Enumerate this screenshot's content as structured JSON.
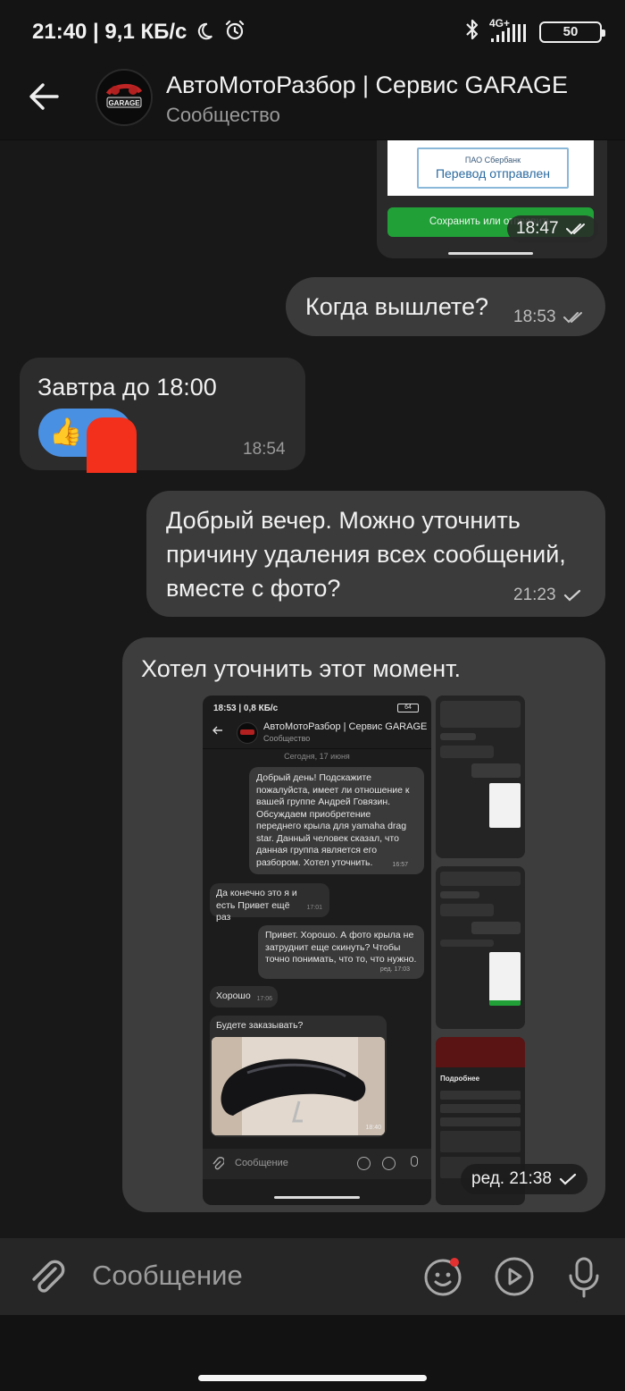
{
  "status_bar": {
    "time_speed": "21:40 | 9,1 КБ/с",
    "network": "4G+",
    "battery": "50",
    "icons": [
      "moon-icon",
      "alarm-icon",
      "bluetooth-icon",
      "signal-icon",
      "battery-icon"
    ]
  },
  "header": {
    "title": "АвтоМотоРазбор  | Сервис GARAGE",
    "subtitle": "Сообщество",
    "avatar_text": "GARAGE"
  },
  "messages": [
    {
      "id": "m1",
      "direction": "out",
      "type": "image-card",
      "card": {
        "bank": "ПАО Сбербанк",
        "status": "Перевод отправлен",
        "button": "Сохранить или отправить"
      },
      "time": "18:47",
      "check": "double"
    },
    {
      "id": "m2",
      "direction": "out",
      "text": "Когда вышлете?",
      "time": "18:53",
      "check": "double"
    },
    {
      "id": "m3",
      "direction": "in",
      "text": "Завтра до 18:00",
      "reaction": "👍",
      "time": "18:54"
    },
    {
      "id": "m4",
      "direction": "out",
      "text": "Добрый вечер. Можно уточнить причину удаления всех сообщений, вместе с фото?",
      "time": "21:23",
      "check": "single"
    },
    {
      "id": "m5",
      "direction": "out",
      "text": "Хотел уточнить этот момент.",
      "time": "ред. 21:38",
      "check": "single"
    }
  ],
  "embedded_screenshot": {
    "status": "18:53 | 0,8 КБ/с",
    "battery": "64",
    "title": "АвтоМотоРазбор  | Сервис GARAGE",
    "subtitle": "Сообщество",
    "date": "Сегодня, 17 июня",
    "messages": [
      {
        "dir": "out",
        "text": "Добрый день! Подскажите пожалуйста, имеет ли отношение к вашей группе Андрей Говязин. Обсуждаем приобретение переднего крыла для yamaha drag star. Данный человек сказал, что данная группа является его разбором. Хотел уточнить.",
        "time": "16:57"
      },
      {
        "dir": "in",
        "text": "Да конечно это я и есть Привет ещё раз",
        "time": "17:01"
      },
      {
        "dir": "out",
        "text": "Привет. Хорошо. А фото крыла не затруднит еще скинуть? Чтобы точно понимать, что то, что нужно.",
        "time": "ред. 17:03"
      },
      {
        "dir": "in",
        "text": "Хорошо",
        "time": "17:06"
      },
      {
        "dir": "in",
        "text": "Будете заказывать?",
        "time": "18:40"
      }
    ],
    "input_placeholder": "Сообщение",
    "side_title": "Подробнее"
  },
  "input": {
    "placeholder": "Сообщение"
  },
  "colors": {
    "background": "#181818",
    "bubble_out": "#3b3b3b",
    "bubble_in": "#2c2c2c",
    "reaction": "#4a90e2",
    "sber_green": "#21a038",
    "badge_red": "#e33030"
  }
}
